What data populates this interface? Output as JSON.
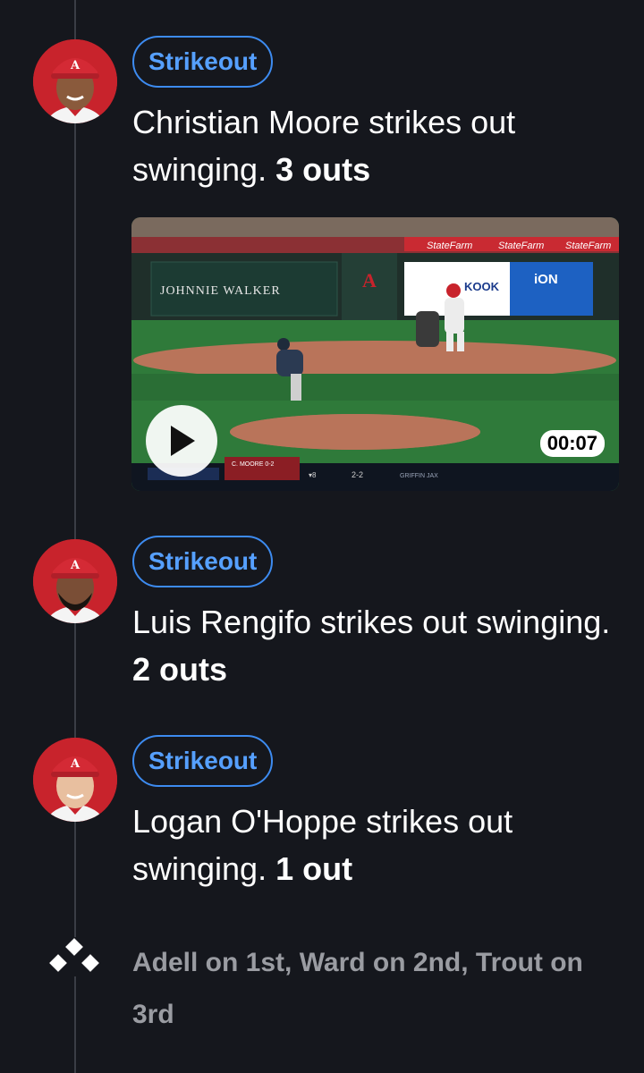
{
  "feed": {
    "plays": [
      {
        "badge": "Strikeout",
        "description": "Christian Moore strikes out swinging.",
        "outs": "3 outs",
        "player_avatar": "angels-player-avatar",
        "video": {
          "duration": "00:07",
          "ad_board_left": "JOHNNIE WALKER",
          "ad_board_center": "KOOK",
          "ad_board_right": "iON",
          "sponsor_banner": "StateFarm",
          "scorebug_batter": "C. MOORE 0-2",
          "scorebug_count": "2-2",
          "scorebug_inning": "▾8",
          "scorebug_pitcher": "GRIFFIN JAX"
        }
      },
      {
        "badge": "Strikeout",
        "description": "Luis Rengifo strikes out swinging.",
        "outs": "2 outs",
        "player_avatar": "angels-player-avatar"
      },
      {
        "badge": "Strikeout",
        "description": "Logan O'Hoppe strikes out swinging.",
        "outs": "1 out",
        "player_avatar": "angels-player-avatar"
      }
    ],
    "base_state": {
      "icon": "bases-diamond-icon",
      "text": "Adell on 1st, Ward on 2nd, Trout on 3rd"
    }
  },
  "colors": {
    "background": "#15171d",
    "badge_blue": "#56a0ff",
    "avatar_red": "#c8232c",
    "muted_text": "#9a9ca2"
  }
}
